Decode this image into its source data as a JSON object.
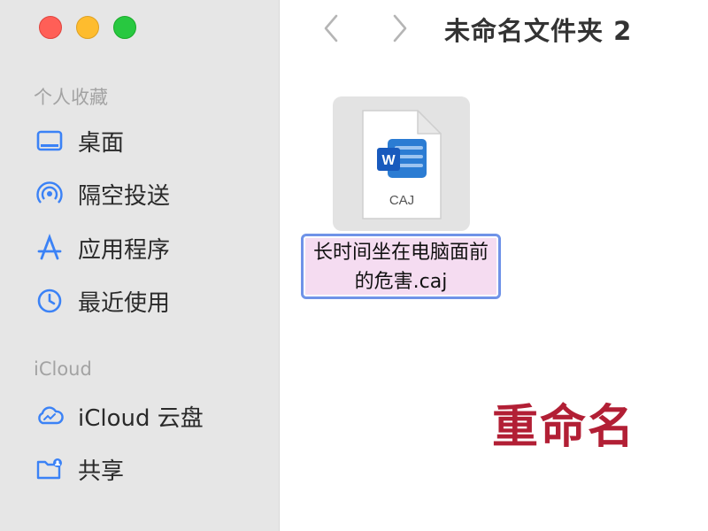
{
  "window": {
    "title": "未命名文件夹 2"
  },
  "sidebar": {
    "favorites": {
      "title": "个人收藏",
      "items": [
        {
          "label": "桌面",
          "icon": "desktop-icon"
        },
        {
          "label": "隔空投送",
          "icon": "airdrop-icon"
        },
        {
          "label": "应用程序",
          "icon": "applications-icon"
        },
        {
          "label": "最近使用",
          "icon": "clock-icon"
        }
      ]
    },
    "icloud": {
      "title": "iCloud",
      "items": [
        {
          "label": "iCloud 云盘",
          "icon": "icloud-drive-icon"
        },
        {
          "label": "共享",
          "icon": "shared-folder-icon"
        }
      ]
    }
  },
  "file": {
    "type_label": "CAJ",
    "badge_letter": "W",
    "name": "长时间坐在电脑面前的危害.caj"
  },
  "caption": "重命名",
  "colors": {
    "accent": "#3b82f6",
    "word_blue": "#185abd",
    "caption_red": "#b21f35",
    "rename_highlight": "#f5dcf1"
  }
}
